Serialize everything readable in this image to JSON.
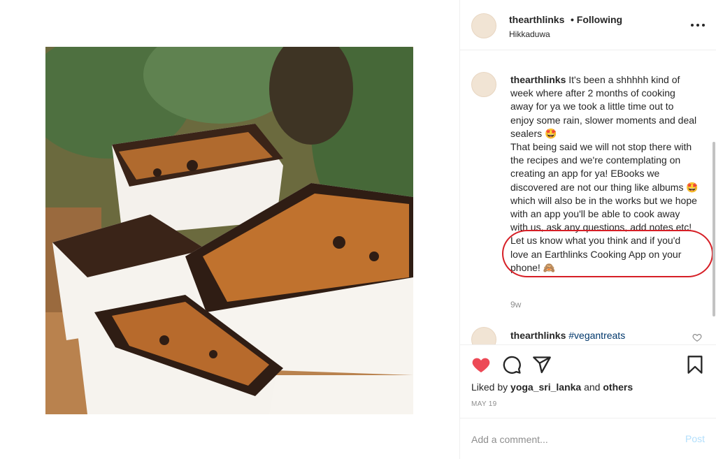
{
  "header": {
    "username": "thearthlinks",
    "follow_status": "• Following",
    "location": "Hikkaduwa",
    "more_icon": "more-dots-icon"
  },
  "caption": {
    "username": "thearthlinks",
    "line1": "It's been a shhhhh kind of week where after 2 months of cooking away for ya we took a little time out to enjoy some rain, slower moments and deal sealers 🤩",
    "line2": "That being said we will not stop there with the recipes and we're contemplating on creating an app for ya! EBooks we discovered are not our thing like albums 🤩 which will also be in the works but we hope with an app you'll be able to cook away with us, ask any questions, add notes etc!",
    "line3": "Let us know what you think and if you'd love an Earthlinks Cooking App on your phone! 🙈",
    "time": "9w"
  },
  "comment2": {
    "username": "thearthlinks",
    "hashtag": "#vegantreats"
  },
  "actions": {
    "likes_prefix": "Liked by",
    "liked_by_user": "yoga_sri_lanka",
    "likes_and": "and",
    "likes_others": "others",
    "date": "MAY 19",
    "liked": true,
    "heart_color": "#ed4956"
  },
  "add_comment": {
    "placeholder": "Add a comment...",
    "post_label": "Post"
  },
  "colors": {
    "highlight_ring": "#d61f26",
    "muted": "#8e8e8e",
    "post_disabled": "#b2dffc"
  }
}
